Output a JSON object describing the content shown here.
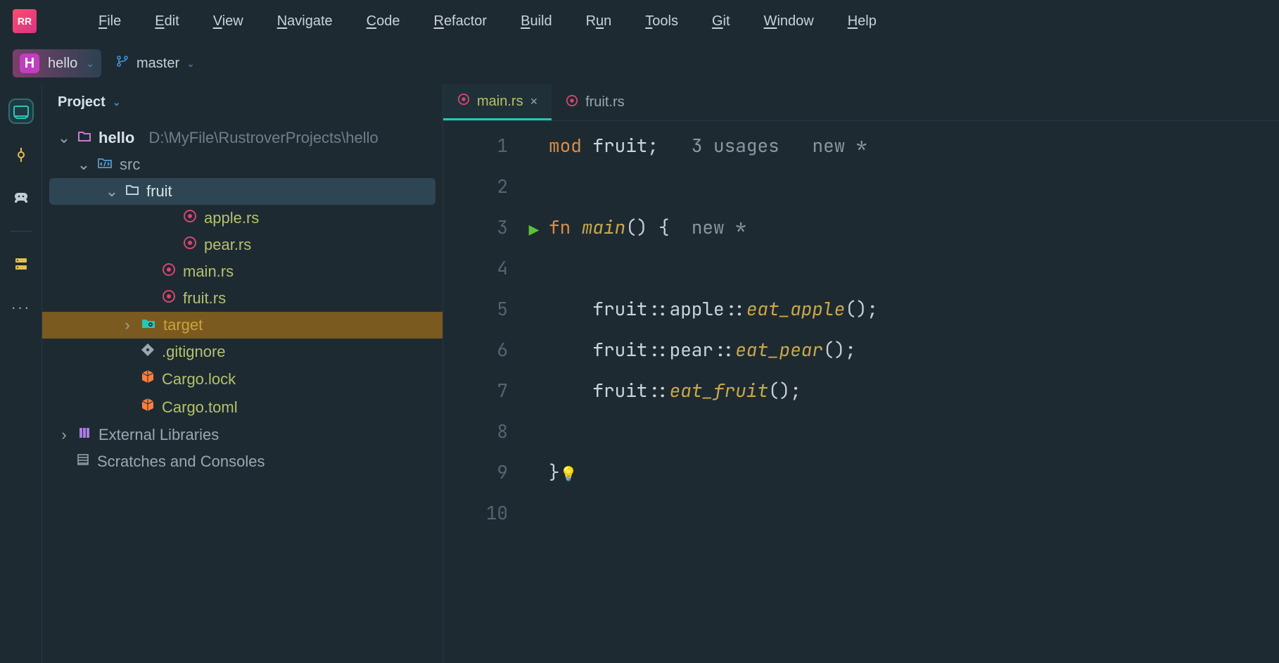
{
  "menu": {
    "items": [
      "File",
      "Edit",
      "View",
      "Navigate",
      "Code",
      "Refactor",
      "Build",
      "Run",
      "Tools",
      "Git",
      "Window",
      "Help"
    ]
  },
  "navbar": {
    "project_letter": "H",
    "project_name": "hello",
    "branch_name": "master"
  },
  "sidebar": {
    "title": "Project",
    "root": {
      "name": "hello",
      "path": "D:\\MyFile\\RustroverProjects\\hello"
    },
    "src_label": "src",
    "fruit_label": "fruit",
    "apple_label": "apple.rs",
    "pear_label": "pear.rs",
    "main_label": "main.rs",
    "fruitrs_label": "fruit.rs",
    "target_label": "target",
    "gitignore_label": ".gitignore",
    "cargolock_label": "Cargo.lock",
    "cargotoml_label": "Cargo.toml",
    "extlib_label": "External Libraries",
    "scratches_label": "Scratches and Consoles"
  },
  "tabs": {
    "active": "main.rs",
    "inactive": "fruit.rs"
  },
  "editor": {
    "usages_hint": "3 usages",
    "new_hint": "new *",
    "lines": {
      "1_kw": "mod ",
      "1_id": "fruit",
      "1_sc": ";",
      "3_kw": "fn ",
      "3_name": "main",
      "3_rest": "() {",
      "5": "    fruit::apple::",
      "5_call": "eat_apple",
      "5_end": "();",
      "6": "    fruit::pear::",
      "6_call": "eat_pear",
      "6_end": "();",
      "7": "    fruit::",
      "7_call": "eat_fruit",
      "7_end": "();",
      "9": "}"
    },
    "line_numbers": [
      "1",
      "2",
      "3",
      "4",
      "5",
      "6",
      "7",
      "8",
      "9",
      "10"
    ]
  }
}
